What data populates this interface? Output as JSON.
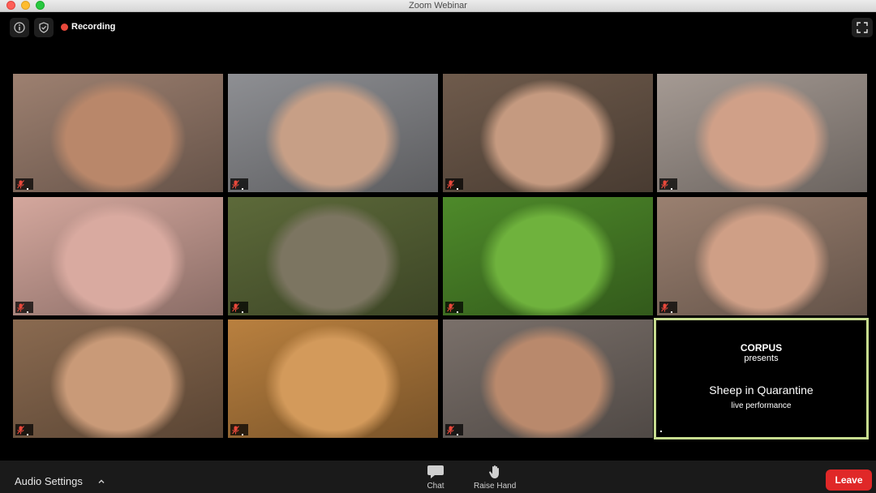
{
  "window": {
    "title": "Zoom Webinar"
  },
  "toolbar": {
    "recording_label": "Recording"
  },
  "tiles": [
    {
      "bg": "#9d8070",
      "skin": "#b9876a"
    },
    {
      "bg": "#8e8f93",
      "skin": "#c79f86"
    },
    {
      "bg": "#6f5b4c",
      "skin": "#c59a80"
    },
    {
      "bg": "#a59a93",
      "skin": "#d0a088"
    },
    {
      "bg": "#d4a79d",
      "skin": "#d9aaa0"
    },
    {
      "bg": "#5d6a3a",
      "skin": "#7c7561"
    },
    {
      "bg": "#4e8a2a",
      "skin": "#6fb23d"
    },
    {
      "bg": "#9a8070",
      "skin": "#cf9f86"
    },
    {
      "bg": "#8a6a50",
      "skin": "#c99a78"
    },
    {
      "bg": "#b9803f",
      "skin": "#d39a5b"
    },
    {
      "bg": "#7a706a",
      "skin": "#b9896c"
    }
  ],
  "banner": {
    "org": "CORPUS",
    "presents": "presents",
    "title": "Sheep in Quarantine",
    "subtitle": "live performance"
  },
  "bottom": {
    "audio_settings": "Audio Settings",
    "chat": "Chat",
    "raise_hand": "Raise Hand",
    "leave": "Leave"
  },
  "colors": {
    "leave": "#e02828",
    "recording": "#e8483b",
    "active_speaker_border": "#c7dc8f"
  }
}
